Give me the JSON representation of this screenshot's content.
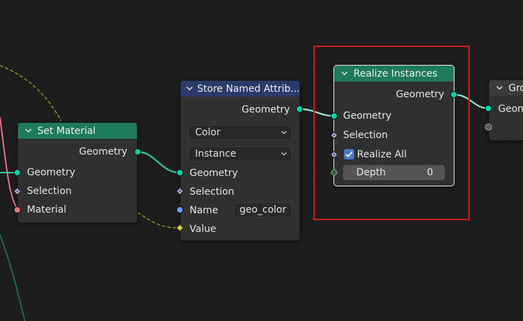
{
  "nodes": {
    "set_material": {
      "title": "Set Material",
      "out_geometry": "Geometry",
      "in_geometry": "Geometry",
      "in_selection": "Selection",
      "in_material": "Material"
    },
    "store_named": {
      "title": "Store Named Attrib...",
      "out_geometry": "Geometry",
      "data_type": "Color",
      "domain": "Instance",
      "in_geometry": "Geometry",
      "in_selection": "Selection",
      "name_label": "Name",
      "name_value": "geo_color",
      "in_value": "Value"
    },
    "realize": {
      "title": "Realize Instances",
      "out_geometry": "Geometry",
      "in_geometry": "Geometry",
      "in_selection": "Selection",
      "realize_all_label": "Realize All",
      "realize_all_checked": true,
      "depth_label": "Depth",
      "depth_value": "0"
    },
    "group_output": {
      "title": "Gro",
      "in_geometry": "Geom"
    }
  },
  "colors": {
    "geometry_socket": "#00d6a3",
    "material_socket": "#eb7582",
    "string_socket": "#63a3ff",
    "value_socket": "#d6d33c",
    "selection_socket": "#b9a3d9",
    "highlight_box": "#d31a1a"
  }
}
